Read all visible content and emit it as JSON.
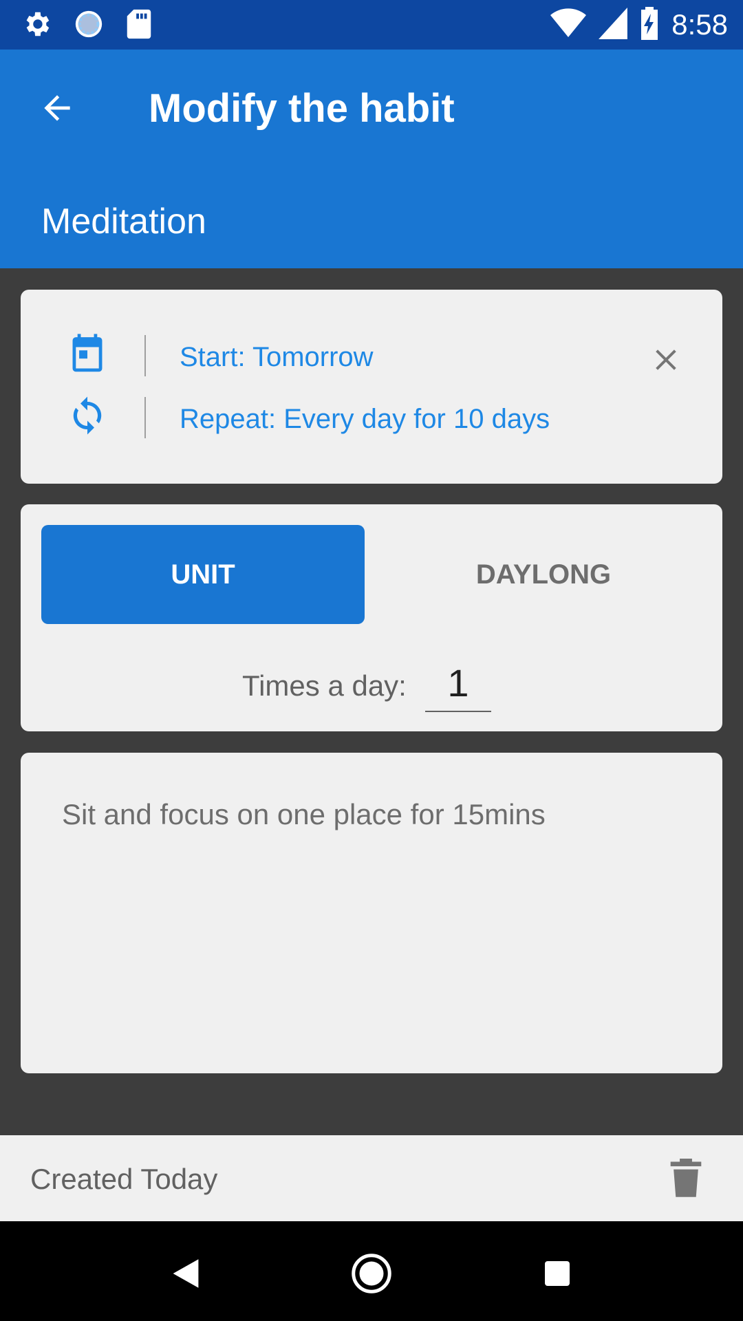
{
  "status_bar": {
    "time": "8:58",
    "left_icons": [
      "settings-icon",
      "loading-icon",
      "sd-card-icon"
    ],
    "right_icons": [
      "wifi-icon",
      "cell-signal-icon",
      "battery-charging-icon"
    ]
  },
  "app_bar": {
    "title": "Modify the habit",
    "habit_name": "Meditation",
    "color": "#1976d2",
    "status_color": "#0d47a1"
  },
  "schedule": {
    "start_label": "Start: Tomorrow",
    "repeat_label": "Repeat: Every day for 10 days",
    "accent": "#1e88e5"
  },
  "mode": {
    "options": [
      "UNIT",
      "DAYLONG"
    ],
    "selected": "UNIT",
    "times_label": "Times a day:",
    "times_value": "1"
  },
  "description": {
    "text": "Sit and focus on one place for 15mins"
  },
  "footer": {
    "created_label": "Created Today"
  }
}
